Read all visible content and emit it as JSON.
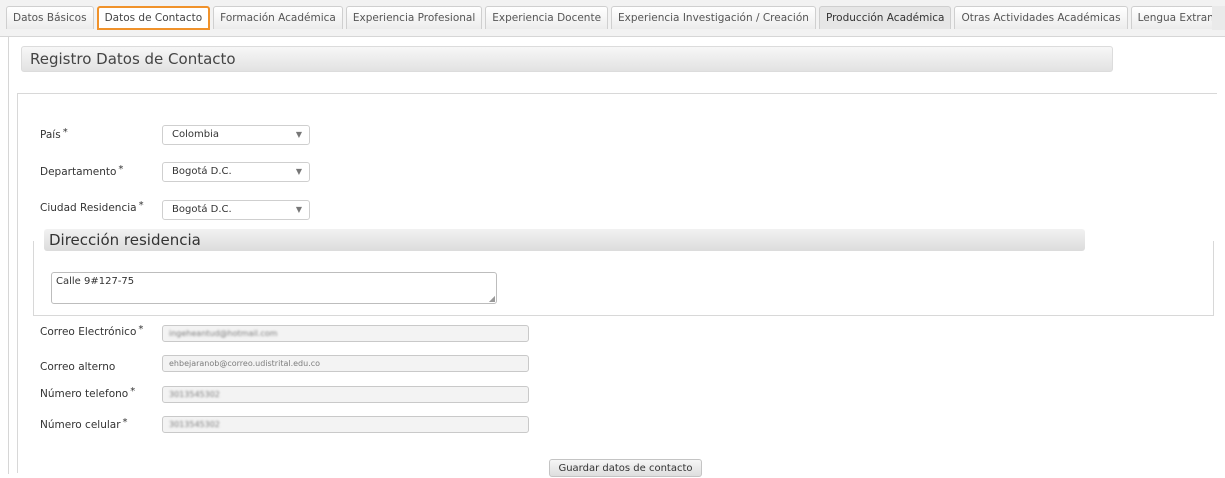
{
  "tabs": [
    {
      "label": "Datos Básicos"
    },
    {
      "label": "Datos de Contacto"
    },
    {
      "label": "Formación Académica"
    },
    {
      "label": "Experiencia Profesional"
    },
    {
      "label": "Experiencia Docente"
    },
    {
      "label": "Experiencia Investigación / Creación"
    },
    {
      "label": "Producción Académica"
    },
    {
      "label": "Otras Actividades Académicas"
    },
    {
      "label": "Lengua Extranjera"
    }
  ],
  "active_tab": "Datos de Contacto",
  "section_title": "Registro Datos de Contacto",
  "required_mark": "*",
  "form": {
    "pais": {
      "label": "País",
      "value": "Colombia"
    },
    "departamento": {
      "label": "Departamento",
      "value": "Bogotá D.C."
    },
    "ciudad": {
      "label": "Ciudad Residencia",
      "value": "Bogotá D.C."
    },
    "direccion": {
      "legend": "Dirección residencia",
      "value": "Calle 9#127-75"
    },
    "correo": {
      "label": "Correo Electrónico",
      "value": "ingeheantud@hotmail.com"
    },
    "correo_alterno": {
      "label": "Correo alterno",
      "value": "ehbejaranob@correo.udistrital.edu.co"
    },
    "telefono": {
      "label": "Número telefono",
      "value": "3013545302"
    },
    "celular": {
      "label": "Número celular",
      "value": "3013545302"
    }
  },
  "submit_label": "Guardar datos de contacto",
  "colors": {
    "active_tab_border": "#f0922b"
  }
}
